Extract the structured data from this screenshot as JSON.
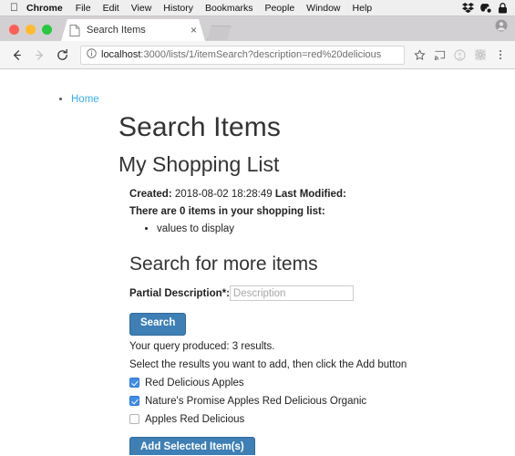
{
  "os_menu": {
    "apple_icon": "apple-logo-icon",
    "items": [
      {
        "label": "Chrome",
        "bold": true
      },
      {
        "label": "File",
        "bold": false
      },
      {
        "label": "Edit",
        "bold": false
      },
      {
        "label": "View",
        "bold": false
      },
      {
        "label": "History",
        "bold": false
      },
      {
        "label": "Bookmarks",
        "bold": false
      },
      {
        "label": "People",
        "bold": false
      },
      {
        "label": "Window",
        "bold": false
      },
      {
        "label": "Help",
        "bold": false
      }
    ],
    "tray_icons": [
      "dropbox-icon",
      "evernote-icon",
      "lock-icon"
    ]
  },
  "browser": {
    "window_controls": [
      "close-button",
      "minimize-button",
      "maximize-button"
    ],
    "tab": {
      "title": "Search Items",
      "favicon": "document-icon",
      "close_label": "×"
    },
    "new_tab_label": "new-tab-button",
    "toolbar": {
      "back_icon": "back-arrow-icon",
      "forward_icon": "forward-arrow-icon",
      "reload_icon": "reload-icon",
      "security_icon": "info-circle-icon",
      "url_host": "localhost",
      "url_rest": ":3000/lists/1/itemSearch?description=red%20delicious",
      "bookmark_icon": "star-icon",
      "cast_icon": "cast-icon",
      "avatar_icon": "profile-avatar-icon",
      "extension_icon": "extension-puzzle-icon",
      "menu_icon": "three-dot-menu-icon"
    }
  },
  "page": {
    "breadcrumb": {
      "home_label": "Home"
    },
    "title": "Search Items",
    "subtitle": "My Shopping List",
    "meta": {
      "created_label": "Created:",
      "created_value": "2018-08-02 18:28:49",
      "modified_label": "Last Modified:",
      "modified_value": "",
      "count_line": "There are 0 items in your shopping list:",
      "items": [
        "values to display"
      ]
    },
    "search_section": {
      "heading": "Search for more items",
      "field_label": "Partial Description*:",
      "field_value": "",
      "field_placeholder": "Description",
      "search_button": "Search"
    },
    "results": {
      "query_line": "Your query produced: 3 results.",
      "instruction_line": "Select the results you want to add, then click the Add button",
      "options": [
        {
          "label": "Red Delicious Apples",
          "checked": true
        },
        {
          "label": "Nature's Promise Apples Red Delicious Organic",
          "checked": true
        },
        {
          "label": "Apples Red Delicious",
          "checked": false
        }
      ],
      "add_button": "Add Selected Item(s)"
    }
  },
  "colors": {
    "link": "#38b0ee",
    "button_primary": "#3e7fb5",
    "checkbox_checked": "#3e8ee8"
  }
}
